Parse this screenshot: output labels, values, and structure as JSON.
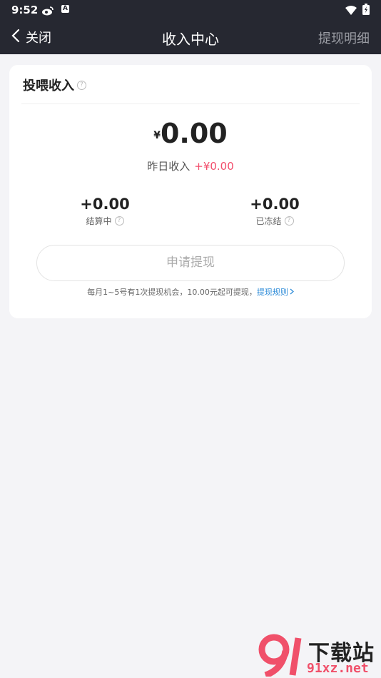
{
  "status": {
    "time": "9:52",
    "badge": "A"
  },
  "nav": {
    "back_label": "关闭",
    "title": "收入中心",
    "right_label": "提现明细"
  },
  "card": {
    "title": "投喂收入",
    "currency": "¥",
    "amount": "0.00",
    "yesterday_label": "昨日收入",
    "yesterday_value": "+¥0.00",
    "settling_value": "+0.00",
    "settling_label": "结算中",
    "frozen_value": "+0.00",
    "frozen_label": "已冻结",
    "withdraw_button": "申请提现",
    "note": "每月1~5号有1次提现机会，10.00元起可提现，",
    "rule_link": "提现规则"
  },
  "watermark": {
    "brand": "下载站",
    "site": "91xz.net"
  },
  "colors": {
    "topbar": "#262831",
    "accent": "#f24d6b",
    "link": "#2f8cd8"
  }
}
